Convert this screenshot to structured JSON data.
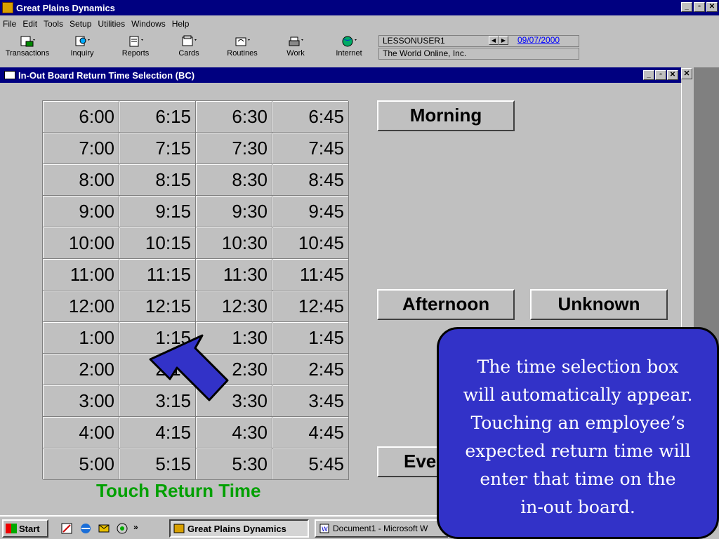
{
  "app": {
    "title": "Great Plains Dynamics",
    "window_buttons": [
      "_",
      "▫",
      "✕"
    ]
  },
  "menu": [
    "File",
    "Edit",
    "Tools",
    "Setup",
    "Utilities",
    "Windows",
    "Help"
  ],
  "toolbar": {
    "buttons": [
      {
        "label": "Transactions",
        "icon": "transactions-icon"
      },
      {
        "label": "Inquiry",
        "icon": "inquiry-icon"
      },
      {
        "label": "Reports",
        "icon": "reports-icon"
      },
      {
        "label": "Cards",
        "icon": "cards-icon"
      },
      {
        "label": "Routines",
        "icon": "routines-icon"
      },
      {
        "label": "Work",
        "icon": "work-icon"
      },
      {
        "label": "Internet",
        "icon": "globe-icon"
      }
    ],
    "user": "LESSONUSER1",
    "date": "09/07/2000",
    "company": "The World Online, Inc."
  },
  "dialog": {
    "title": "In-Out Board Return Time Selection (BC)",
    "times": [
      [
        "6:00",
        "6:15",
        "6:30",
        "6:45"
      ],
      [
        "7:00",
        "7:15",
        "7:30",
        "7:45"
      ],
      [
        "8:00",
        "8:15",
        "8:30",
        "8:45"
      ],
      [
        "9:00",
        "9:15",
        "9:30",
        "9:45"
      ],
      [
        "10:00",
        "10:15",
        "10:30",
        "10:45"
      ],
      [
        "11:00",
        "11:15",
        "11:30",
        "11:45"
      ],
      [
        "12:00",
        "12:15",
        "12:30",
        "12:45"
      ],
      [
        "1:00",
        "1:15",
        "1:30",
        "1:45"
      ],
      [
        "2:00",
        "2:15",
        "2:30",
        "2:45"
      ],
      [
        "3:00",
        "3:15",
        "3:30",
        "3:45"
      ],
      [
        "4:00",
        "4:15",
        "4:30",
        "4:45"
      ],
      [
        "5:00",
        "5:15",
        "5:30",
        "5:45"
      ]
    ],
    "morning_label": "Morning",
    "afternoon_label": "Afternoon",
    "unknown_label": "Unknown",
    "evening_label": "Eve",
    "instruction": "Touch Return Time"
  },
  "callout": {
    "lines": [
      "The time selection box",
      "will automatically appear.",
      "Touching an employee’s",
      "expected return time will",
      "enter that time on the",
      "in-out board."
    ]
  },
  "taskbar": {
    "start_label": "Start",
    "more": "»",
    "tasks": [
      {
        "label": "Great Plains Dynamics",
        "active": true
      },
      {
        "label": "Document1 - Microsoft W",
        "active": false
      }
    ]
  },
  "colors": {
    "titlebar": "#000080",
    "callout": "#3232c8",
    "instruction": "#00a000",
    "arrow": "#3232c8"
  }
}
